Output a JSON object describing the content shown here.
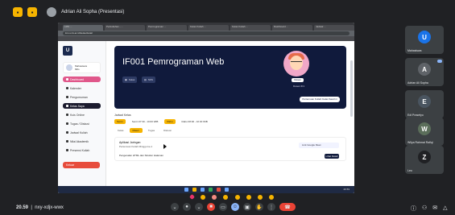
{
  "presenter": {
    "label": "Adrian Ali Sopha (Presentasi)"
  },
  "browser": {
    "tabs": [
      "LMS ...",
      "Perkuliahan - ...",
      "Pemrograman ...",
      "Kelas Kuliah ...",
      "Kelas Kuliah ...",
      "Dashboard ...",
      "Jadwal ..."
    ],
    "url": "lms.univ.ac.id/kelas/detail"
  },
  "lms": {
    "logo": "U",
    "user": {
      "name": "Mahasiswa",
      "role": "Mhs"
    },
    "menu": [
      {
        "label": "Dashboard",
        "style": "active-pink"
      },
      {
        "label": "Kalender",
        "style": ""
      },
      {
        "label": "Pengumuman",
        "style": ""
      },
      {
        "label": "Kelas Saya",
        "style": "dark"
      },
      {
        "label": "Kuis Online",
        "style": ""
      },
      {
        "label": "Tugas / Diskusi",
        "style": ""
      },
      {
        "label": "Jadwal Kuliah",
        "style": ""
      },
      {
        "label": "Nilai Akademik",
        "style": ""
      },
      {
        "label": "Presensi Kuliah",
        "style": ""
      }
    ],
    "logout_label": "Keluar",
    "course": {
      "title": "IF001 Pemrograman Web",
      "pills": [
        "Kelas",
        "SKS"
      ],
      "lecturer_tag": "Dosen",
      "lecturer_name": "Dosen IF1",
      "cta": "Pertemuan Kuliah Kelas Saat Ini"
    },
    "schedule_label": "Jadwal Kelas",
    "schedule": [
      {
        "day": "Senin",
        "time": "Senin 07:30 - 10:00 WIB"
      },
      {
        "day": "Rabu",
        "time": "Rabu 08:00 - 10:30 WIB"
      }
    ],
    "tabs": [
      "Kelas",
      "Materi",
      "Tugas",
      "Diskusi"
    ],
    "active_tab_index": 1,
    "card": {
      "title": "Aplikasi Jaringan",
      "subtitle": "Pertemuan Kuliah Minggu ke-1",
      "link": "Link Google Meet",
      "item": "Pengenalan HTML dan Struktur Halaman",
      "button": "Lihat Detail"
    },
    "taskbar_clock": "20.59"
  },
  "participants": [
    {
      "name": "Mahasiswa",
      "initial": "U",
      "color": "#1a73e8"
    },
    {
      "name": "Adrian Ali Sopha",
      "initial": "A",
      "color": "#5f6368"
    },
    {
      "name": "Edi Prasetyo",
      "initial": "E",
      "color": "#4a5560"
    },
    {
      "name": "Wilya Rahmat Rafiqi",
      "initial": "W",
      "color": "#5b6e5a"
    },
    {
      "name": "Leo",
      "initial": "Z",
      "color": "#202124"
    }
  ],
  "meeting": {
    "time": "20.59",
    "code": "nxy-xdjx-wwx"
  }
}
